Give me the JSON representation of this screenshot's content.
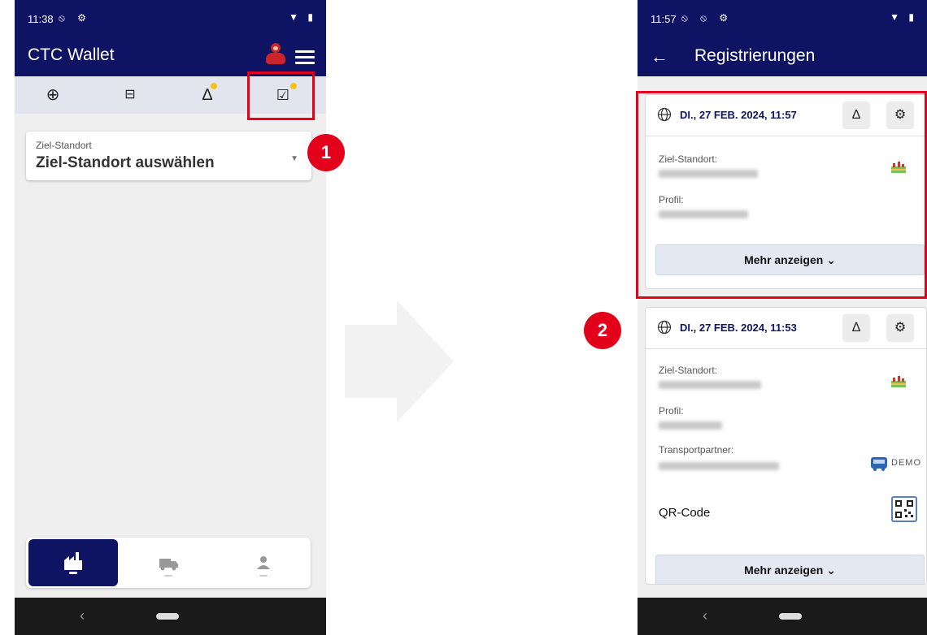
{
  "phone1": {
    "status": {
      "time": "11:38",
      "left_icons": "⦸ ⚙",
      "right_icons": "▼ ▮"
    },
    "app_title": "CTC Wallet",
    "toolbar": {
      "icons": [
        "plus-circle-icon",
        "save-icon",
        "bell-icon",
        "checklist-icon"
      ],
      "glyphs": [
        "⊕",
        "⊟",
        "∆",
        "☑"
      ]
    },
    "field": {
      "label": "Ziel-Standort",
      "value": "Ziel-Standort auswählen"
    },
    "bottom_nav": [
      "factory-icon",
      "truck-icon",
      "person-icon"
    ],
    "nav": {
      "back": "‹"
    }
  },
  "badges": {
    "one": "1",
    "two": "2"
  },
  "phone2": {
    "status": {
      "time": "11:57",
      "left_icons": "⦸ ⦸ ⚙",
      "right_icons": "▼ ▮"
    },
    "back_glyph": "←",
    "title": "Registrierungen",
    "cards": [
      {
        "date": "DI., 27 FEB. 2024, 11:57",
        "fields": [
          "Ziel-Standort:",
          "Profil:"
        ],
        "more": "Mehr anzeigen ⌄"
      },
      {
        "date": "DI., 27 FEB. 2024, 11:53",
        "fields": [
          "Ziel-Standort:",
          "Profil:",
          "Transportpartner:"
        ],
        "demo": "DEMO",
        "qr_label": "QR-Code",
        "more": "Mehr anzeigen ⌄"
      }
    ],
    "bell_glyph": "∆",
    "gear_glyph": "⚙",
    "nav": {
      "back": "‹"
    }
  },
  "colors": {
    "navy": "#0e1363",
    "red": "#e3001b",
    "accent_dot": "#f3c316"
  }
}
